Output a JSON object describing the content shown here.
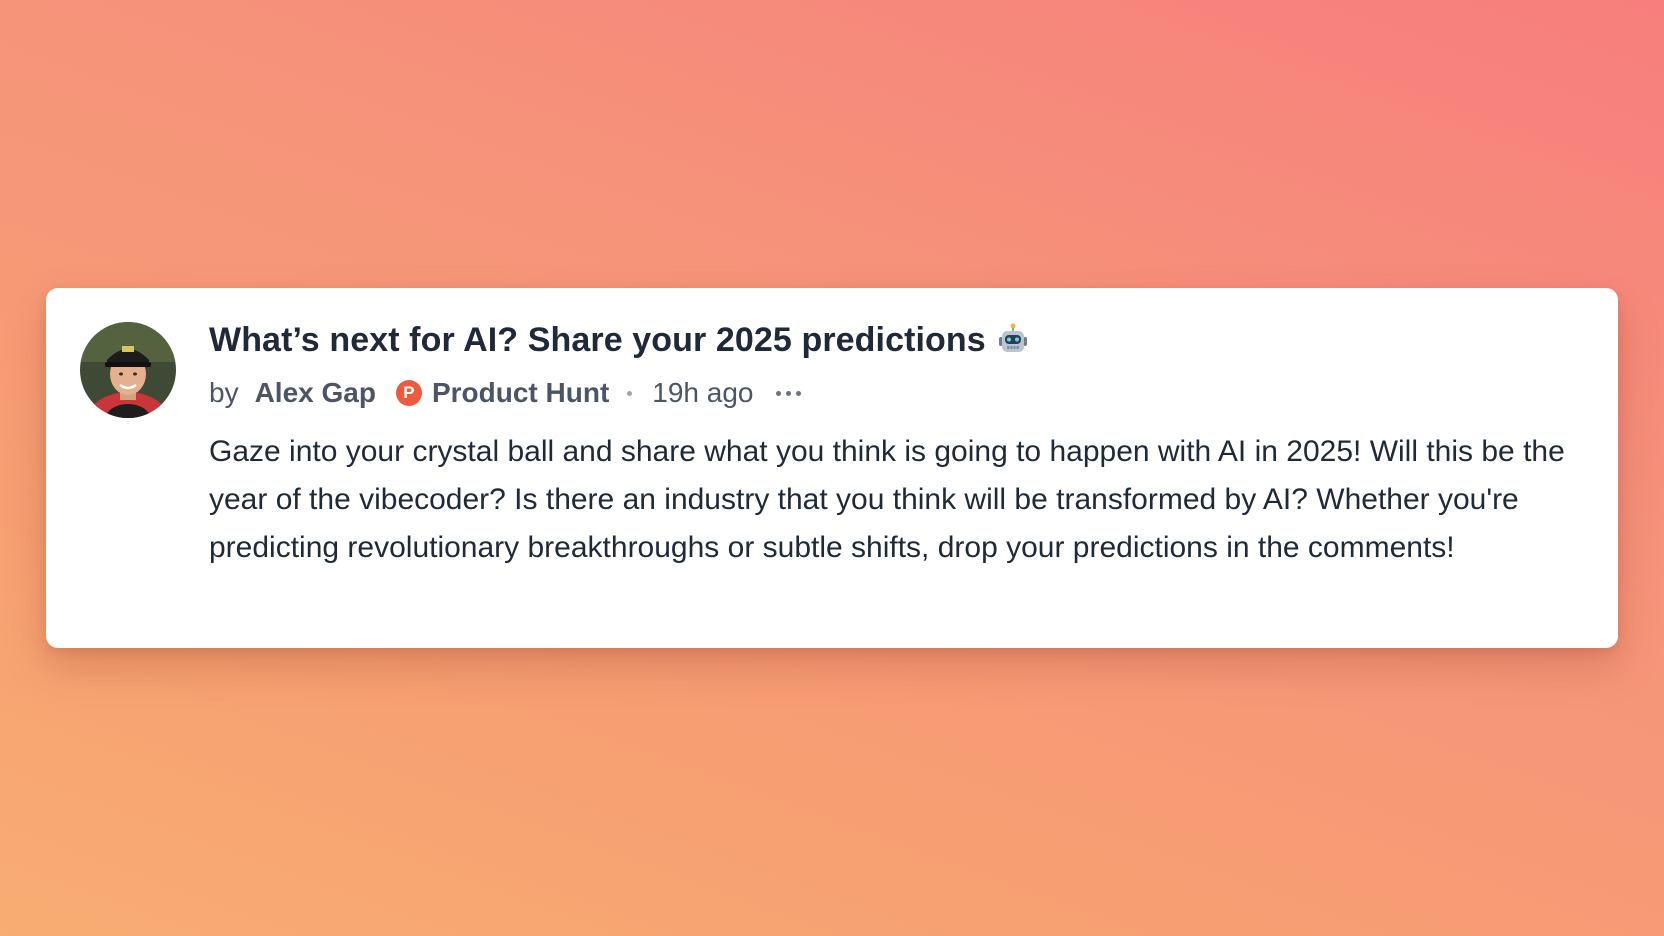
{
  "post": {
    "title": "What’s next for AI? Share your 2025 predictions",
    "title_icon": "robot-icon",
    "by_label": "by",
    "author": "Alex Gap",
    "org_badge_letter": "P",
    "org": "Product Hunt",
    "time": "19h ago",
    "more_icon": "more-icon",
    "body": "Gaze into your crystal ball and share what you think is going to happen with AI in 2025! Will this be the year of the vibecoder? Is there an industry that you think will be transformed by AI? Whether you're predicting revolutionary breakthroughs or subtle shifts, drop your predictions in the comments!"
  },
  "colors": {
    "brand": "#ee5a3e",
    "text_primary": "#1f2937",
    "text_secondary": "#4b5563"
  }
}
